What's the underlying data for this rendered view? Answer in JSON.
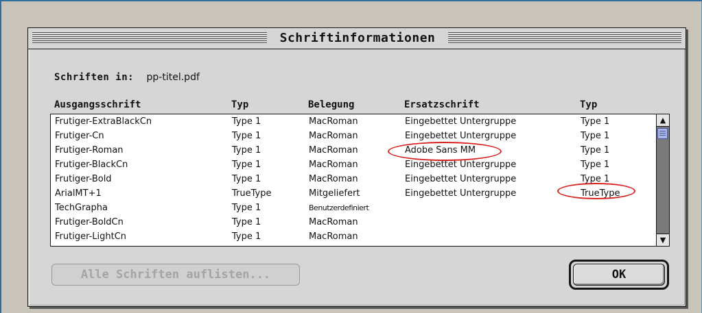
{
  "dialog": {
    "title": "Schriftinformationen",
    "fonts_in_label": "Schriften in:",
    "file_name": "pp-titel.pdf"
  },
  "columns": {
    "source_font": "Ausgangsschrift",
    "type": "Typ",
    "encoding": "Belegung",
    "substitute": "Ersatzschrift",
    "type2": "Typ"
  },
  "rows": [
    {
      "font": "Frutiger-ExtraBlackCn",
      "type": "Type 1",
      "encoding": "MacRoman",
      "substitute": "Eingebettet Untergruppe",
      "type2": "Type 1"
    },
    {
      "font": "Frutiger-Cn",
      "type": "Type 1",
      "encoding": "MacRoman",
      "substitute": "Eingebettet Untergruppe",
      "type2": "Type 1"
    },
    {
      "font": "Frutiger-Roman",
      "type": "Type 1",
      "encoding": "MacRoman",
      "substitute": "Adobe Sans MM",
      "type2": "Type 1"
    },
    {
      "font": "Frutiger-BlackCn",
      "type": "Type 1",
      "encoding": "MacRoman",
      "substitute": "Eingebettet Untergruppe",
      "type2": "Type 1"
    },
    {
      "font": "Frutiger-Bold",
      "type": "Type 1",
      "encoding": "MacRoman",
      "substitute": "Eingebettet Untergruppe",
      "type2": "Type 1"
    },
    {
      "font": "ArialMT+1",
      "type": "TrueType",
      "encoding": "Mitgeliefert",
      "substitute": "Eingebettet Untergruppe",
      "type2": "TrueType"
    },
    {
      "font": "TechGrapha",
      "type": "Type 1",
      "encoding": "Benutzerdefiniert",
      "substitute": "",
      "type2": ""
    },
    {
      "font": "Frutiger-BoldCn",
      "type": "Type 1",
      "encoding": "MacRoman",
      "substitute": "",
      "type2": ""
    },
    {
      "font": "Frutiger-LightCn",
      "type": "Type 1",
      "encoding": "MacRoman",
      "substitute": "",
      "type2": ""
    }
  ],
  "scrollbar": {
    "up_icon": "arrow-up-icon",
    "down_icon": "arrow-down-icon"
  },
  "buttons": {
    "list_all": "Alle Schriften auflisten...",
    "ok": "OK"
  },
  "colors": {
    "annotation": "#d9231f",
    "scroll_thumb": "#a9b6e6"
  }
}
